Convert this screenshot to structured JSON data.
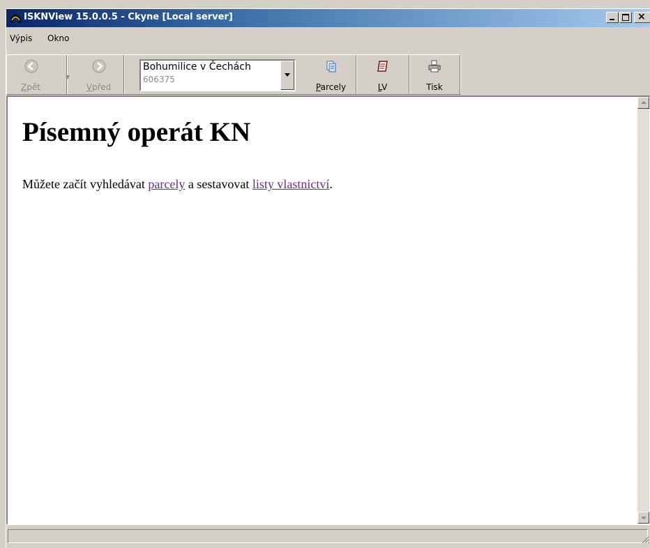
{
  "window": {
    "title": "ISKNView 15.0.0.5 - Ckyne [Local server]",
    "title_bar_colors": {
      "start": "#0a246a",
      "end": "#a6caf0"
    }
  },
  "menu": {
    "items": [
      {
        "label": "Výpis"
      },
      {
        "label": "Okno"
      }
    ]
  },
  "toolbar": {
    "back": {
      "accel": "Z",
      "rest": "pět",
      "icon": "back-arrow-icon",
      "enabled": false
    },
    "forward": {
      "accel": "V",
      "rest": "před",
      "icon": "forward-arrow-icon",
      "enabled": false
    },
    "location": {
      "name": "Bohumilice v Čechách",
      "code": "606375"
    },
    "parcely": {
      "accel": "P",
      "rest": "arcely",
      "icon": "document-icon"
    },
    "lv": {
      "accel": "L",
      "rest": "V",
      "icon": "notebook-icon"
    },
    "tisk": {
      "label": "Tisk",
      "icon": "printer-icon"
    }
  },
  "page": {
    "heading": "Písemný operát KN",
    "text_before": "Můžete začít vyhledávat ",
    "link_parcely": "parcely",
    "text_middle": " a sestavovat ",
    "link_lv": "listy vlastnictví",
    "text_after": ".",
    "link_color": "#6b2c86"
  },
  "statusbar": {
    "text": ""
  }
}
